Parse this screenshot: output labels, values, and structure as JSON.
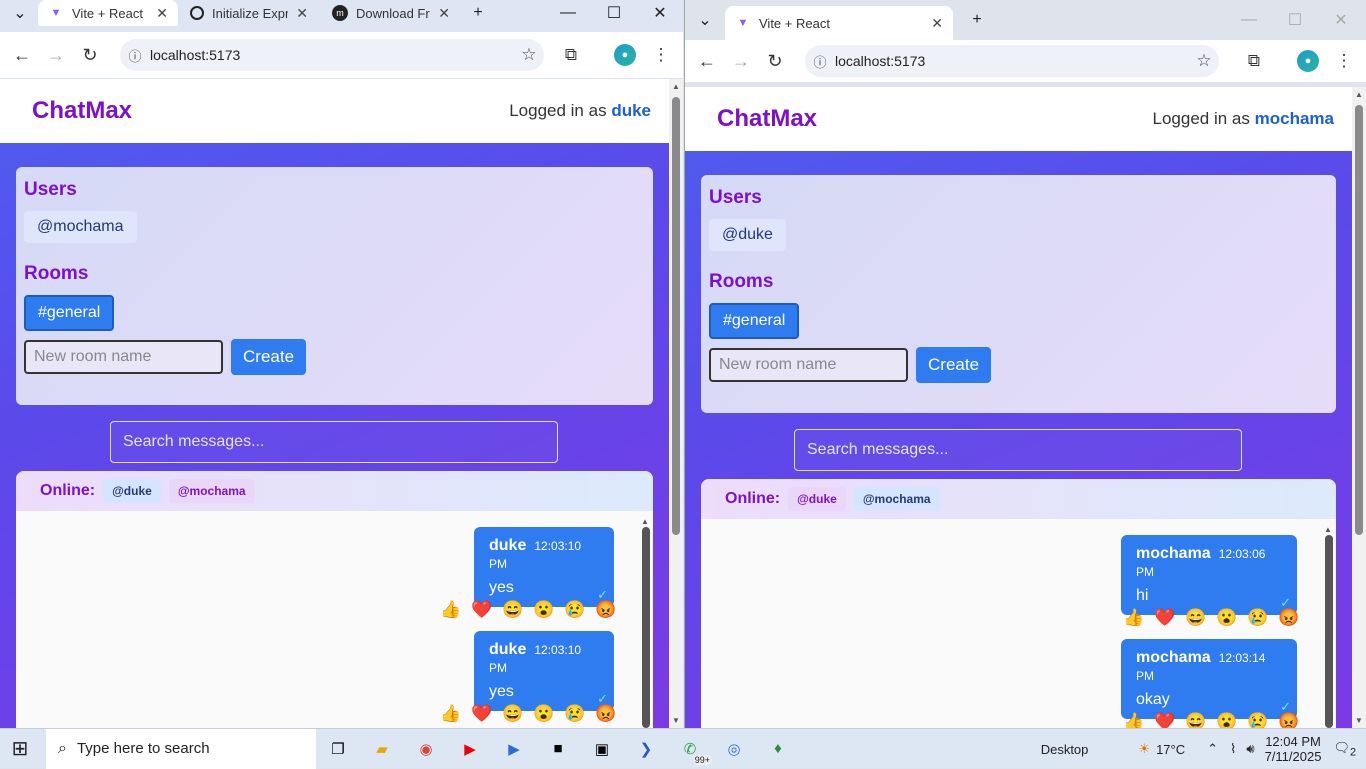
{
  "left": {
    "tabs": [
      {
        "title": "Vite + React",
        "active": true
      },
      {
        "title": "Initialize Expr",
        "active": false
      },
      {
        "title": "Download Fr",
        "active": false
      }
    ],
    "url": "localhost:5173",
    "app": {
      "brand": "ChatMax",
      "logged_prefix": "Logged in as",
      "username": "duke",
      "users_title": "Users",
      "users": [
        "@mochama"
      ],
      "rooms_title": "Rooms",
      "rooms": [
        "#general"
      ],
      "new_room_placeholder": "New room name",
      "create_label": "Create",
      "search_placeholder": "Search messages...",
      "online_label": "Online:",
      "online_users": [
        "@duke",
        "@mochama"
      ],
      "messages": [
        {
          "sender": "duke",
          "time": "12:03:10 PM",
          "text": "yes",
          "check": "✓"
        },
        {
          "sender": "duke",
          "time": "12:03:10 PM",
          "text": "yes",
          "check": "✓"
        }
      ]
    }
  },
  "right": {
    "tabs": [
      {
        "title": "Vite + React",
        "active": true
      }
    ],
    "url": "localhost:5173",
    "app": {
      "brand": "ChatMax",
      "logged_prefix": "Logged in as",
      "username": "mochama",
      "users_title": "Users",
      "users": [
        "@duke"
      ],
      "rooms_title": "Rooms",
      "rooms": [
        "#general"
      ],
      "new_room_placeholder": "New room name",
      "create_label": "Create",
      "search_placeholder": "Search messages...",
      "online_label": "Online:",
      "online_users": [
        "@duke",
        "@mochama"
      ],
      "messages": [
        {
          "sender": "mochama",
          "time": "12:03:06 PM",
          "text": "hi",
          "check": "✓"
        },
        {
          "sender": "mochama",
          "time": "12:03:14 PM",
          "text": "okay",
          "check": "✓"
        }
      ]
    }
  },
  "reactions": [
    "👍",
    "❤️",
    "😄",
    "😮",
    "😢",
    "😡"
  ],
  "taskbar": {
    "search_placeholder": "Type here to search",
    "desktop_label": "Desktop",
    "weather": "17°C",
    "time": "12:04 PM",
    "date": "7/11/2025",
    "notifications": "2",
    "badge": "99+"
  },
  "colors": {
    "brand": "#7b12c8",
    "accent": "#2f7cf0",
    "username": "#1c5fd6"
  }
}
